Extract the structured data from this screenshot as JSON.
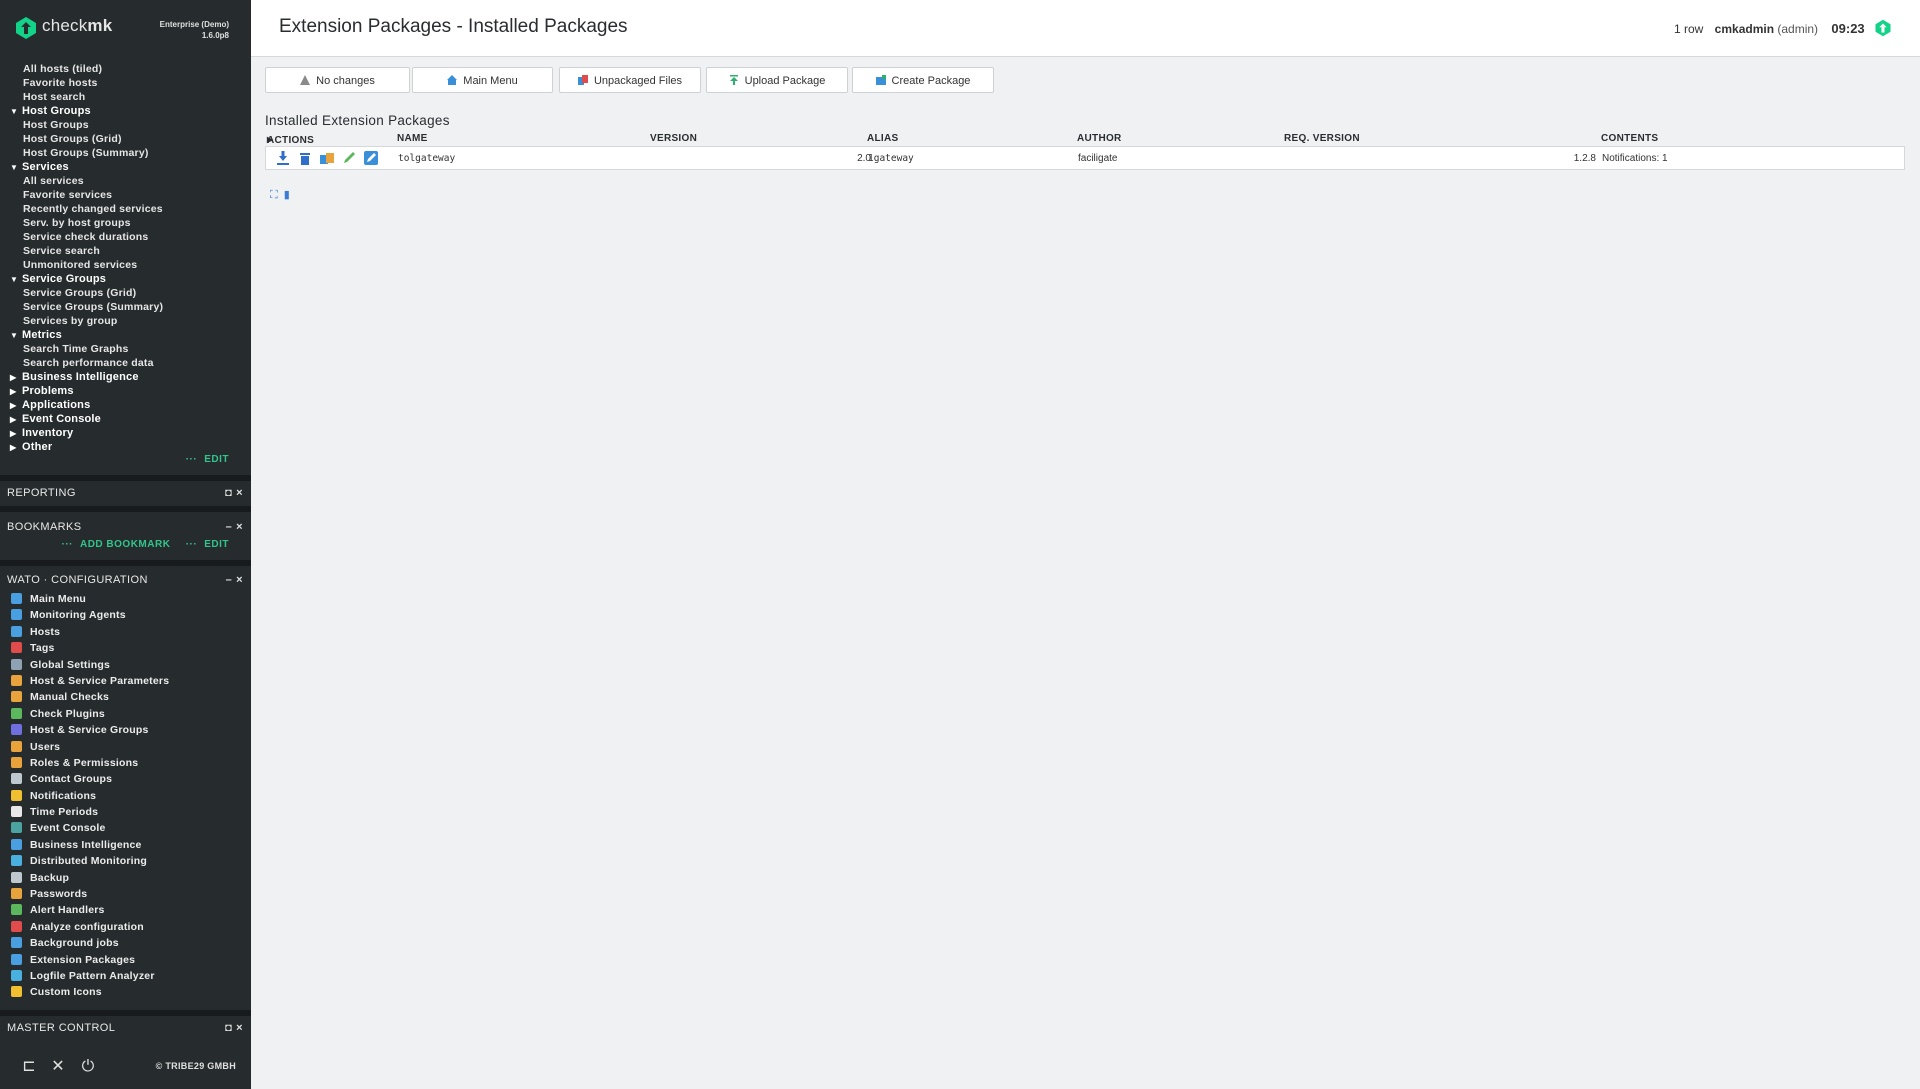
{
  "brand": {
    "name_light": "check",
    "name_bold": "mk",
    "edition_line1": "Enterprise (Demo)",
    "edition_line2": "1.6.0p8"
  },
  "views": [
    {
      "kind": "link",
      "label": "All hosts (tiled)"
    },
    {
      "kind": "link",
      "label": "Favorite hosts"
    },
    {
      "kind": "link",
      "label": "Host search"
    },
    {
      "kind": "head",
      "label": "Host Groups",
      "open": true
    },
    {
      "kind": "link",
      "label": "Host Groups"
    },
    {
      "kind": "link",
      "label": "Host Groups (Grid)"
    },
    {
      "kind": "link",
      "label": "Host Groups (Summary)"
    },
    {
      "kind": "head",
      "label": "Services",
      "open": true
    },
    {
      "kind": "link",
      "label": "All services"
    },
    {
      "kind": "link",
      "label": "Favorite services"
    },
    {
      "kind": "link",
      "label": "Recently changed services"
    },
    {
      "kind": "link",
      "label": "Serv. by host groups"
    },
    {
      "kind": "link",
      "label": "Service check durations"
    },
    {
      "kind": "link",
      "label": "Service search"
    },
    {
      "kind": "link",
      "label": "Unmonitored services"
    },
    {
      "kind": "head",
      "label": "Service Groups",
      "open": true
    },
    {
      "kind": "link",
      "label": "Service Groups (Grid)"
    },
    {
      "kind": "link",
      "label": "Service Groups (Summary)"
    },
    {
      "kind": "link",
      "label": "Services by group"
    },
    {
      "kind": "head",
      "label": "Metrics",
      "open": true
    },
    {
      "kind": "link",
      "label": "Search Time Graphs"
    },
    {
      "kind": "link",
      "label": "Search performance data"
    },
    {
      "kind": "head",
      "label": "Business Intelligence",
      "open": false
    },
    {
      "kind": "head",
      "label": "Problems",
      "open": false
    },
    {
      "kind": "head",
      "label": "Applications",
      "open": false
    },
    {
      "kind": "head",
      "label": "Event Console",
      "open": false
    },
    {
      "kind": "head",
      "label": "Inventory",
      "open": false
    },
    {
      "kind": "head",
      "label": "Other",
      "open": false
    }
  ],
  "views_edit": "EDIT",
  "snapins": {
    "reporting": "REPORTING",
    "bookmarks": "BOOKMARKS",
    "add_bookmark": "ADD BOOKMARK",
    "bookmarks_edit": "EDIT",
    "wato": "WATO · CONFIGURATION",
    "master": "MASTER CONTROL"
  },
  "wato_items": [
    {
      "label": "Main Menu",
      "icon": "main-menu-icon",
      "color": "#4a9fe0"
    },
    {
      "label": "Monitoring Agents",
      "icon": "agents-icon",
      "color": "#4a9fe0"
    },
    {
      "label": "Hosts",
      "icon": "hosts-icon",
      "color": "#4a9fe0"
    },
    {
      "label": "Tags",
      "icon": "tags-icon",
      "color": "#e04b4b"
    },
    {
      "label": "Global Settings",
      "icon": "gear-icon",
      "color": "#8fa2b3"
    },
    {
      "label": "Host & Service Parameters",
      "icon": "parameters-icon",
      "color": "#e8a33c"
    },
    {
      "label": "Manual Checks",
      "icon": "manual-checks-icon",
      "color": "#e8a33c"
    },
    {
      "label": "Check Plugins",
      "icon": "puzzle-icon",
      "color": "#5cb85c"
    },
    {
      "label": "Host & Service Groups",
      "icon": "groups-icon",
      "color": "#6f6fe0"
    },
    {
      "label": "Users",
      "icon": "users-icon",
      "color": "#e8a33c"
    },
    {
      "label": "Roles & Permissions",
      "icon": "roles-icon",
      "color": "#e8a33c"
    },
    {
      "label": "Contact Groups",
      "icon": "contact-groups-icon",
      "color": "#bfc7cf"
    },
    {
      "label": "Notifications",
      "icon": "bell-icon",
      "color": "#f0c030"
    },
    {
      "label": "Time Periods",
      "icon": "clock-icon",
      "color": "#e8e8e8"
    },
    {
      "label": "Event Console",
      "icon": "event-console-icon",
      "color": "#4aa3a0"
    },
    {
      "label": "Business Intelligence",
      "icon": "bi-icon",
      "color": "#4a9fe0"
    },
    {
      "label": "Distributed Monitoring",
      "icon": "globe-icon",
      "color": "#4ab0e0"
    },
    {
      "label": "Backup",
      "icon": "backup-icon",
      "color": "#bfc7cf"
    },
    {
      "label": "Passwords",
      "icon": "key-icon",
      "color": "#e8a33c"
    },
    {
      "label": "Alert Handlers",
      "icon": "alert-handlers-icon",
      "color": "#5cb85c"
    },
    {
      "label": "Analyze configuration",
      "icon": "heart-icon",
      "color": "#e04b4b"
    },
    {
      "label": "Background jobs",
      "icon": "list-icon",
      "color": "#4a9fe0"
    },
    {
      "label": "Extension Packages",
      "icon": "package-icon",
      "color": "#4a9fe0"
    },
    {
      "label": "Logfile Pattern Analyzer",
      "icon": "flask-icon",
      "color": "#4ab0e0"
    },
    {
      "label": "Custom Icons",
      "icon": "custom-icons-icon",
      "color": "#f0c030"
    }
  ],
  "footer": {
    "copyright": "© TRIBE29 GMBH"
  },
  "header": {
    "title": "Extension Packages - Installed Packages",
    "rows": "1 row",
    "user": "cmkadmin",
    "role": "(admin)",
    "clock": "09:23"
  },
  "toolbar": {
    "no_changes": "No changes",
    "main_menu": "Main Menu",
    "unpackaged": "Unpackaged Files",
    "upload": "Upload Package",
    "create": "Create Package"
  },
  "packages": {
    "section_title": "Installed Extension Packages",
    "columns": [
      "ACTIONS",
      "NAME",
      "VERSION",
      "ALIAS",
      "AUTHOR",
      "REQ. VERSION",
      "CONTENTS"
    ],
    "rows": [
      {
        "name": "tolgateway",
        "version": "2.0",
        "alias": "1gateway",
        "author": "faciligate",
        "req_version": "1.2.8",
        "contents": "Notifications: 1"
      }
    ]
  },
  "colors": {
    "accent": "#13d389",
    "sidebar_bg": "#262b2e"
  }
}
